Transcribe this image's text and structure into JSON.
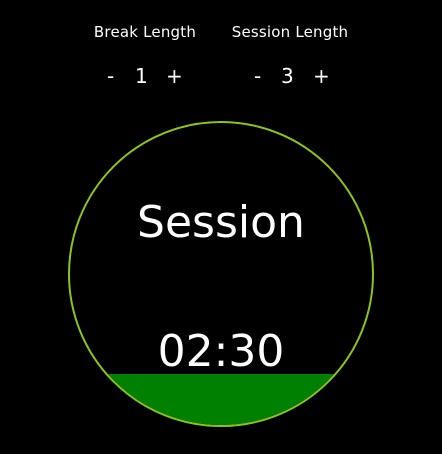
{
  "break": {
    "label": "Break Length",
    "decrement": "-",
    "value": "1",
    "increment": "+"
  },
  "session": {
    "label": "Session Length",
    "decrement": "-",
    "value": "3",
    "increment": "+"
  },
  "timer": {
    "mode": "Session",
    "time": "02:30",
    "fill_fraction": 0.17,
    "ring_color": "#8dc21f",
    "fill_color": "#008000"
  }
}
